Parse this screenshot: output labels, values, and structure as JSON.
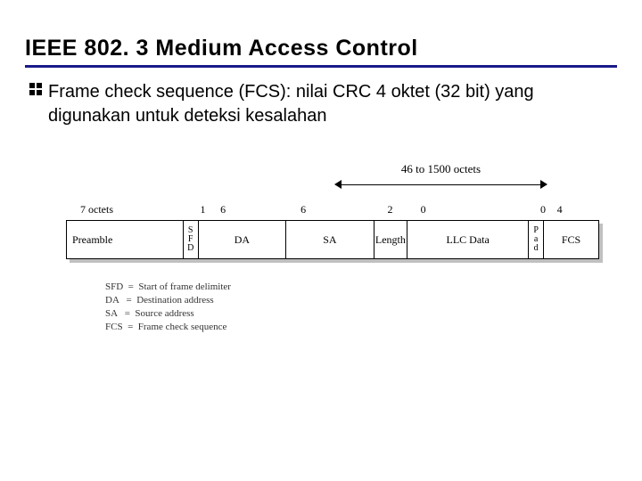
{
  "title": "IEEE 802. 3 Medium Access Control",
  "bullet": "Frame check sequence (FCS): nilai CRC 4 oktet (32 bit) yang digunakan untuk deteksi kesalahan",
  "range_label": "46 to 1500 octets",
  "col_labels": {
    "preamble": "7 octets",
    "sfd": "1",
    "da": "6",
    "sa": "6",
    "len": "2",
    "llc": "0",
    "pad": "0",
    "fcs": "4"
  },
  "fields": {
    "preamble": "Preamble",
    "sfd_v": [
      "S",
      "F",
      "D"
    ],
    "da": "DA",
    "sa": "SA",
    "len": "Length",
    "llc": "LLC Data",
    "pad_v": [
      "P",
      "a",
      "d"
    ],
    "fcs": "FCS"
  },
  "legend": {
    "sfd": "SFD  =  Start of frame delimiter",
    "da": "DA   =  Destination address",
    "sa": "SA   =  Source address",
    "fcs": "FCS  =  Frame check sequence"
  }
}
